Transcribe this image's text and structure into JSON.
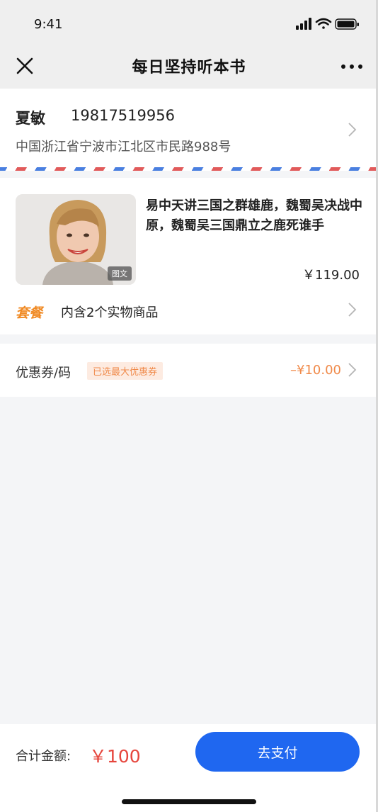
{
  "status_bar": {
    "time": "9:41",
    "icons": [
      "signal-icon",
      "wifi-icon",
      "battery-icon"
    ]
  },
  "nav": {
    "title": "每日坚持听本书",
    "close_icon": "close-icon",
    "more_icon": "more-icon"
  },
  "address": {
    "name": "夏敏",
    "phone": "19817519956",
    "detail": "中国浙江省宁波市江北区市民路988号"
  },
  "product": {
    "title": "易中天讲三国之群雄鹿，魏蜀吴决战中原，魏蜀吴三国鼎立之鹿死谁手",
    "cover_tag": "图文",
    "price": "￥119.00",
    "package_badge": "套餐",
    "package_text": "内含2个实物商品"
  },
  "coupon": {
    "label": "优惠券/码",
    "tag": "已选最大优惠券",
    "value": "–¥10.00"
  },
  "footer": {
    "total_label": "合计金额:",
    "total_value": "￥100",
    "pay_label": "去支付"
  },
  "colors": {
    "accent": "#1f67f0",
    "price_red": "#e6453c",
    "coupon_orange": "#f08a4a",
    "package_orange": "#f08a24"
  }
}
